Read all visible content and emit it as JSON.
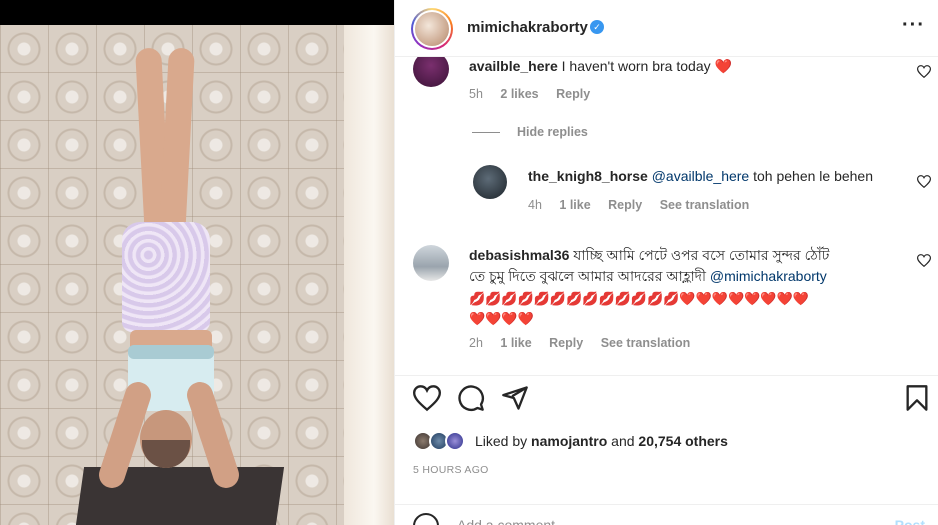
{
  "post": {
    "username": "mimichakraborty",
    "verified_mark": "✓",
    "more_glyph": "···"
  },
  "comments": [
    {
      "user": "availble_here",
      "text": "I haven't worn bra today",
      "emoji": "❤️",
      "time": "5h",
      "likes": "2 likes",
      "reply": "Reply"
    },
    {
      "user": "the_knigh8_horse",
      "mention": "@availble_here",
      "text": "toh pehen le behen",
      "time": "4h",
      "likes": "1 like",
      "reply": "Reply",
      "translate": "See translation"
    },
    {
      "user": "debasishmal36",
      "text_line1": "যাচ্ছি আমি পেটে ওপর বসে তোমার সুন্দর ঠোঁট",
      "text_line2": "তে চুমু দিতে বুঝলে আমার আদরের আহ্লাদী",
      "mention": "@mimichakraborty",
      "emoji_line1": "💋💋💋💋💋💋💋💋💋💋💋💋💋❤️❤️❤️❤️❤️❤️❤️❤️",
      "emoji_line2": "❤️❤️❤️❤️",
      "time": "2h",
      "likes": "1 like",
      "reply": "Reply",
      "translate": "See translation"
    }
  ],
  "hide_replies": "Hide replies",
  "likes": {
    "prefix": "Liked by",
    "user": "namojantro",
    "middle": "and",
    "others": "20,754 others"
  },
  "timestamp": "5 HOURS AGO",
  "add_comment": {
    "placeholder": "Add a comment...",
    "post_label": "Post"
  },
  "colors": {
    "accent": "#3897f0",
    "mention": "#00376b",
    "muted": "#8e8e8e",
    "post_disabled": "#b2dffc"
  },
  "icons": [
    "heart-icon",
    "comment-icon",
    "share-icon",
    "bookmark-icon",
    "more-options-icon",
    "emoji-icon",
    "verified-badge-icon"
  ]
}
